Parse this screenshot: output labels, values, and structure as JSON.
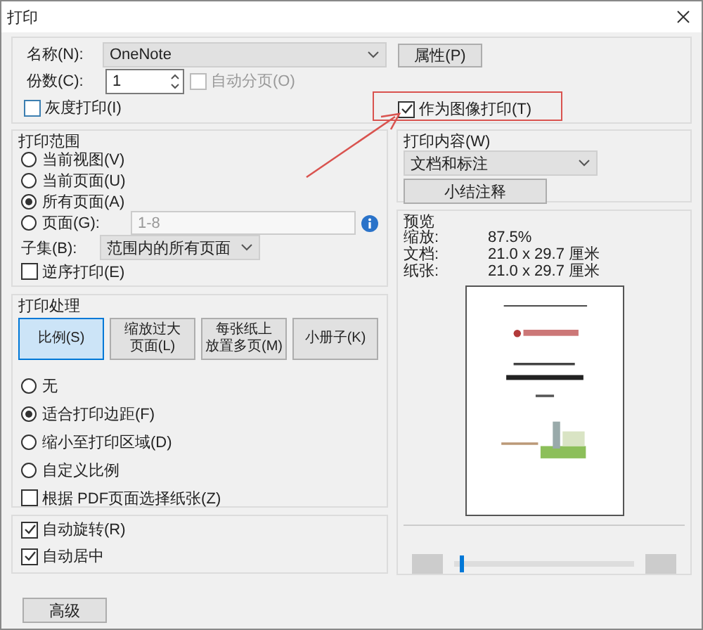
{
  "window": {
    "title": "打印"
  },
  "printer": {
    "label": "名称(N):",
    "value": "OneNote",
    "properties_button": "属性(P)"
  },
  "copies": {
    "label": "份数(C):",
    "value": "1"
  },
  "collate": {
    "label": "自动分页(O)",
    "checked": false,
    "disabled": true
  },
  "grayscale": {
    "label": "灰度打印(I)",
    "checked": false
  },
  "print_as_image": {
    "label": "作为图像打印(T)",
    "checked": true
  },
  "print_range": {
    "title": "打印范围",
    "options": [
      {
        "label": "当前视图(V)",
        "selected": false
      },
      {
        "label": "当前页面(U)",
        "selected": false
      },
      {
        "label": "所有页面(A)",
        "selected": true
      },
      {
        "label": "页面(G):",
        "selected": false
      }
    ],
    "pages_field": {
      "value": "1-8",
      "disabled": true
    },
    "subset": {
      "label": "子集(B):",
      "value": "范围内的所有页面"
    },
    "reverse": {
      "label": "逆序打印(E)",
      "checked": false
    }
  },
  "page_handling": {
    "title": "打印处理",
    "modes": [
      {
        "lines": [
          "比例(S)"
        ],
        "selected": true
      },
      {
        "lines": [
          "缩放过大",
          "页面(L)"
        ],
        "selected": false
      },
      {
        "lines": [
          "每张纸上",
          "放置多页(M)"
        ],
        "selected": false
      },
      {
        "lines": [
          "小册子(K)"
        ],
        "selected": false
      }
    ],
    "scale_options": [
      {
        "label": "无",
        "selected": false
      },
      {
        "label": "适合打印边距(F)",
        "selected": true
      },
      {
        "label": "缩小至打印区域(D)",
        "selected": false
      },
      {
        "label": "自定义比例",
        "selected": false
      }
    ],
    "paper_by_pdf": {
      "label": "根据 PDF页面选择纸张(Z)",
      "checked": false
    }
  },
  "orientation": [
    {
      "label": "自动旋转(R)",
      "checked": true
    },
    {
      "label": "自动居中",
      "checked": true
    }
  ],
  "advanced_button": "高级",
  "print_content": {
    "title": "打印内容(W)",
    "value": "文档和标注",
    "summarize_button": "小结注释"
  },
  "preview": {
    "title": "预览",
    "rows": [
      {
        "label": "缩放:",
        "value": "87.5%"
      },
      {
        "label": "文档:",
        "value": "21.0 x 29.7 厘米"
      },
      {
        "label": "纸张:",
        "value": "21.0 x 29.7 厘米"
      }
    ],
    "page_slider": {
      "level": 0.03
    }
  }
}
